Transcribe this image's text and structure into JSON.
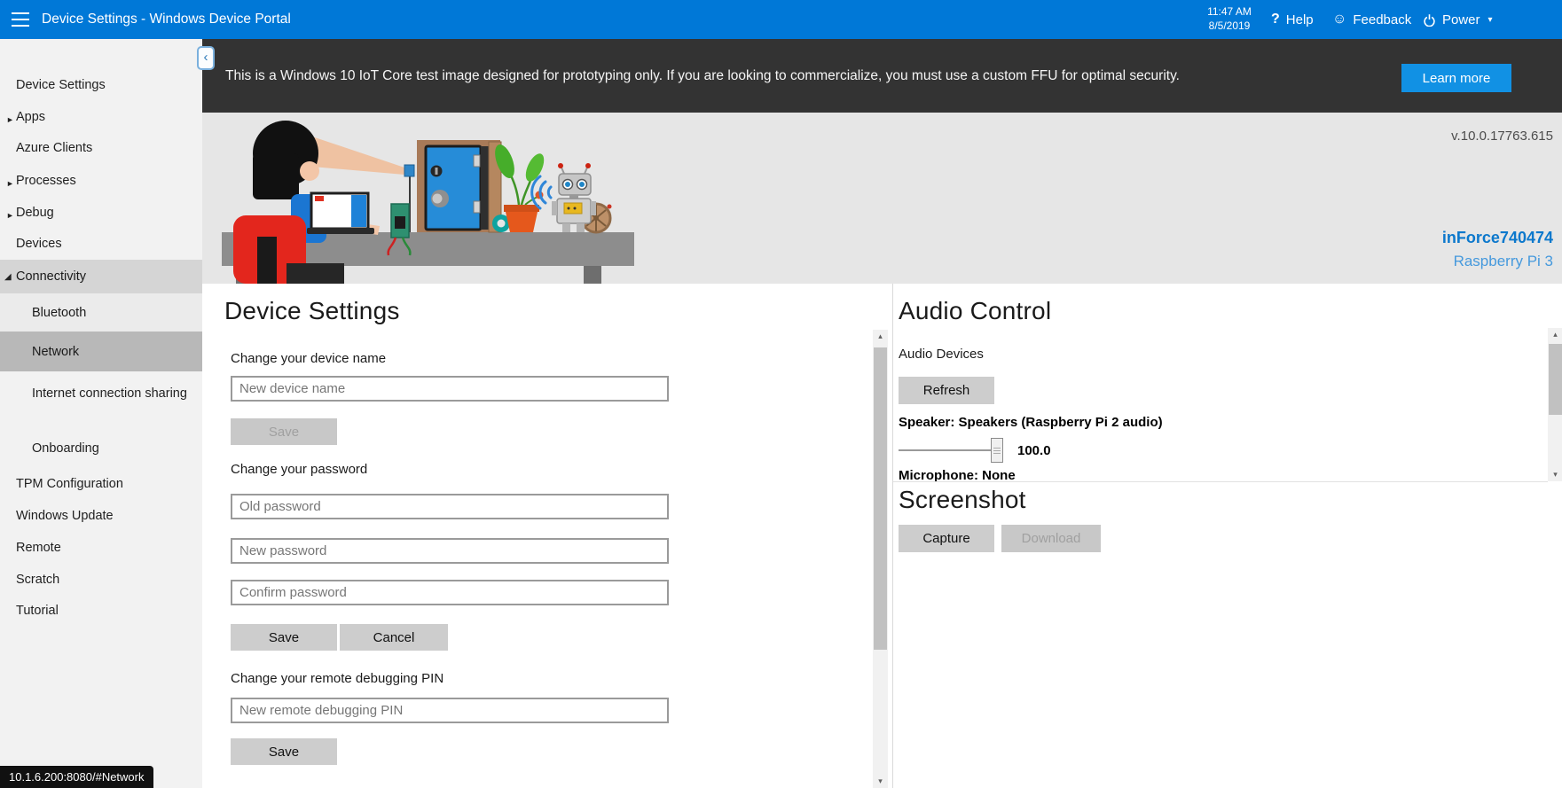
{
  "topbar": {
    "title": "Device Settings - Windows Device Portal",
    "time": "11:47 AM",
    "date": "8/5/2019",
    "help_icon": "?",
    "help_label": "Help",
    "feedback_icon": "☺",
    "feedback_label": "Feedback",
    "power_label": "Power",
    "power_caret": "▾"
  },
  "sidebar": {
    "collapse_icon": "‹",
    "items": [
      {
        "label": "Device Settings",
        "arrow": ""
      },
      {
        "label": "Apps",
        "arrow": "►"
      },
      {
        "label": "Azure Clients",
        "arrow": ""
      },
      {
        "label": "Processes",
        "arrow": "►"
      },
      {
        "label": "Debug",
        "arrow": "►"
      },
      {
        "label": "Devices",
        "arrow": ""
      },
      {
        "label": "Connectivity",
        "arrow": "◢"
      },
      {
        "label": "Bluetooth",
        "arrow": ""
      },
      {
        "label": "Network",
        "arrow": ""
      },
      {
        "label": "Internet connection sharing",
        "arrow": ""
      },
      {
        "label": "Onboarding",
        "arrow": ""
      },
      {
        "label": "TPM Configuration",
        "arrow": ""
      },
      {
        "label": "Windows Update",
        "arrow": ""
      },
      {
        "label": "Remote",
        "arrow": ""
      },
      {
        "label": "Scratch",
        "arrow": ""
      },
      {
        "label": "Tutorial",
        "arrow": ""
      }
    ]
  },
  "banner": {
    "message": "This is a Windows 10 IoT Core test image designed for prototyping only. If you are looking to commercialize, you must use a custom FFU for optimal security.",
    "learn_more_label": "Learn more"
  },
  "hero": {
    "version": "v.10.0.17763.615",
    "device_name": "inForce740474",
    "device_model": "Raspberry Pi 3"
  },
  "device_settings": {
    "title": "Device Settings",
    "change_name_label": "Change your device name",
    "name_placeholder": "New device name",
    "save_label": "Save",
    "cancel_label": "Cancel",
    "change_password_label": "Change your password",
    "old_password_placeholder": "Old password",
    "new_password_placeholder": "New password",
    "confirm_password_placeholder": "Confirm password",
    "change_pin_label": "Change your remote debugging PIN",
    "pin_placeholder": "New remote debugging PIN"
  },
  "audio_control": {
    "title": "Audio Control",
    "devices_label": "Audio Devices",
    "refresh_label": "Refresh",
    "speaker_label": "Speaker: Speakers (Raspberry Pi 2 audio)",
    "volume_value": "100.0",
    "microphone_label": "Microphone: None"
  },
  "screenshot": {
    "title": "Screenshot",
    "capture_label": "Capture",
    "download_label": "Download"
  },
  "status_tooltip": {
    "url": "10.1.6.200:8080/#Network"
  },
  "scrollbar": {
    "up_icon": "▴",
    "down_icon": "▾"
  },
  "colors": {
    "accent": "#0078d7",
    "banner_bg": "#333333",
    "learn_more_bg": "#1191e4",
    "hero_bg": "#e6e6e6",
    "sidebar_selected": "#b8b8b8",
    "device_name_link": "#0c78cc"
  }
}
